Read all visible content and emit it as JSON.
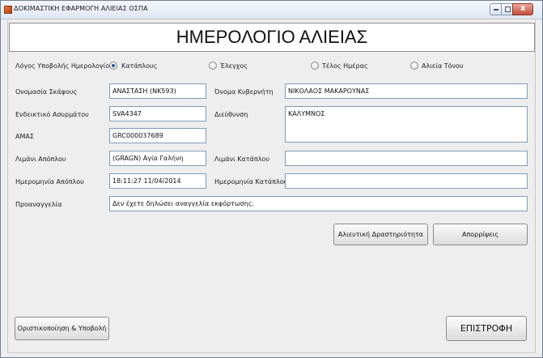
{
  "window": {
    "title": "ΔΟΚΙΜΑΣΤΙΚΗ ΕΦΑΡΜΟΓΗ ΑΛΙΕΙΑΣ ΟΣΠΑ",
    "close_glyph": "x"
  },
  "header": {
    "title": "ΗΜΕΡΟΛΟΓΙΟ ΑΛΙΕΙΑΣ"
  },
  "reason": {
    "label": "Λόγος Υποβολής Ημερολογίου",
    "options": [
      {
        "label": "Κατάπλους",
        "selected": true
      },
      {
        "label": "Έλεγχος",
        "selected": false
      },
      {
        "label": "Τέλος Ημέρας",
        "selected": false
      },
      {
        "label": "Αλιεία Τόνου",
        "selected": false
      }
    ]
  },
  "form": {
    "vessel_name": {
      "label": "Ονομασία Σκάφους",
      "value": "ΑΝΑΣΤΑΣΗ (ΝΚ593)"
    },
    "captain_name": {
      "label": "Όνομα Κυβερνήτη",
      "value": "ΝΙΚΟΛΑΟΣ ΜΑΚΑΡΟΥΝΑΣ"
    },
    "radio_callsign": {
      "label": "Ενδεικτικό Ασυρμάτου",
      "value": "SVA4347"
    },
    "address": {
      "label": "Διεύθυνση",
      "value": "ΚΑΛΥΜΝΟΣ"
    },
    "amas": {
      "label": "ΑΜΑΣ",
      "value": "GRC000037689"
    },
    "departure_port": {
      "label": "Λιμάνι Απόπλου",
      "value": "(GRAGN) Αγία Γαλήνη"
    },
    "arrival_port": {
      "label": "Λιμάνι Κατάπλου",
      "value": ""
    },
    "departure_date": {
      "label": "Ημερομηνία Απόπλου",
      "value": "18:11:27 11/04/2014"
    },
    "arrival_date": {
      "label": "Ημερομηνία Κατάπλου",
      "value": ""
    },
    "pre_notification": {
      "label": "Προαναγγελία",
      "value": "Δεν έχετε δηλώσει αναγγελία εκφόρτωσης."
    }
  },
  "buttons": {
    "fishing_activity": "Αλιευτική Δραστηριότητα",
    "discards": "Απορρίψεις",
    "finalize_submit": "Οριστικοποίηση & Υποβολή",
    "return": "ΕΠΙΣΤΡΟΦΗ"
  }
}
